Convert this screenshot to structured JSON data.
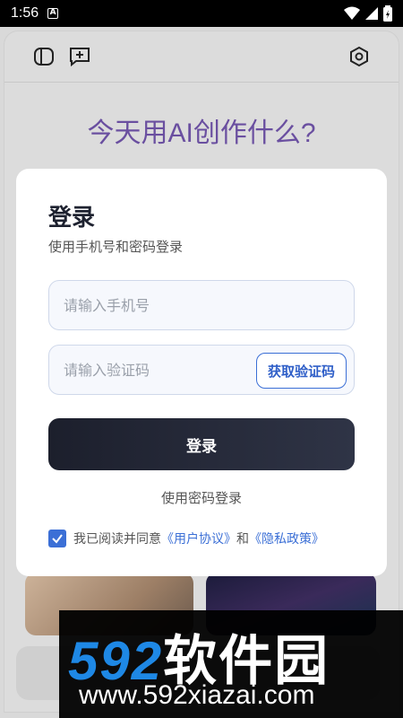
{
  "status_bar": {
    "time": "1:56",
    "notification_icon": "A"
  },
  "app": {
    "hero_title": "今天用AI创作什么?",
    "icons": [
      "sidebar-icon",
      "new-chat-icon",
      "settings-icon"
    ]
  },
  "modal": {
    "title": "登录",
    "subtitle": "使用手机号和密码登录",
    "phone_placeholder": "请输入手机号",
    "code_placeholder": "请输入验证码",
    "get_code_label": "获取验证码",
    "login_label": "登录",
    "password_login_label": "使用密码登录",
    "agreement": {
      "prefix": "我已阅读并同意",
      "user_agreement": "《用户协议》",
      "and": "和",
      "privacy_policy": "《隐私政策》",
      "checked": true
    }
  },
  "watermark": {
    "brand": "592",
    "brand_cn": "软件园",
    "url": "www.592xiazai.com"
  },
  "colors": {
    "accent": "#3b6fd6",
    "hero": "#6a4fa0",
    "button": "#1c1f2c"
  }
}
